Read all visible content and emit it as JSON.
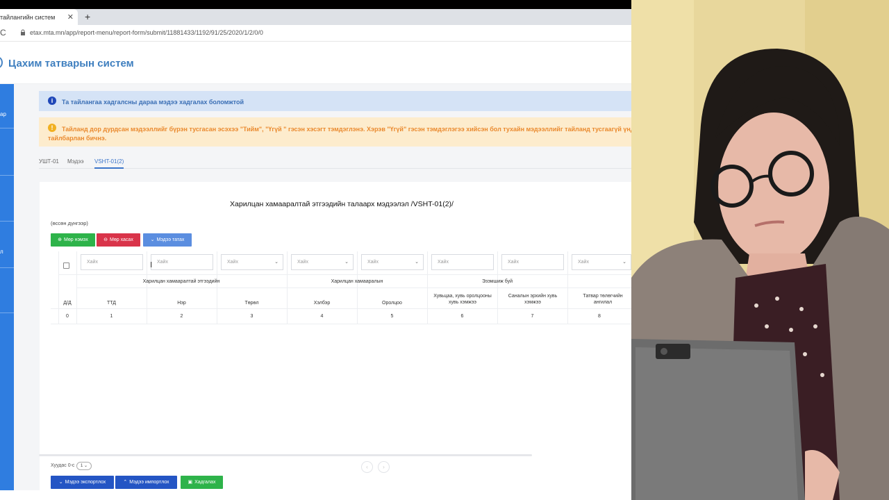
{
  "browser": {
    "tab_title": "тайлангийн систем",
    "tab_close": "✕",
    "new_tab": "+",
    "reload": "C",
    "url": "etax.mta.mn/app/report-menu/report-form/submit/11881433/1192/91/25/2020/1/2/0/0"
  },
  "app": {
    "title": "Цахим татварын систем"
  },
  "sidebar": {
    "items": [
      {
        "label": "ар"
      },
      {
        "label": "л"
      }
    ]
  },
  "alerts": {
    "info_icon": "i",
    "info": "Та тайлангаа хадгалсны дараа мэдээ хадгалах боломжтой",
    "warn_icon": "!",
    "warn_line1": "Тайланд дор дурдсан мэдээллийг бүрэн тусгасан эсэхээ \"Тийм\", \"Үгүй \" гэсэн хэсэгт тэмдэглэнэ. Хэрэв \"Үгүй\" гэсэн тэмдэглэгээ хийсэн бол тухайн мэдээллийг тайланд тусгаагүй үндэсл",
    "warn_line2": "тайлбарлан бичнэ."
  },
  "form_tabs": [
    {
      "label": "УШТ-01"
    },
    {
      "label": "Мэдээ"
    },
    {
      "label": "VSHT-01(2)"
    }
  ],
  "report": {
    "title": "Харилцан хамааралтай этгээдийн талаарх мэдээлэл /VSHT-01(2)/",
    "unit_note": "(өссөн дүнгээр)",
    "buttons": {
      "add_row": "Мөр нэмэх",
      "add_row_icon": "⊕",
      "remove_row": "Мөр хасах",
      "remove_row_icon": "⊖",
      "download": "Мэдээ татах",
      "download_icon": "⌄"
    },
    "filters": [
      {
        "placeholder": "Хайх",
        "type": "text"
      },
      {
        "placeholder": "Хайх",
        "type": "text"
      },
      {
        "placeholder": "Хайх",
        "type": "select"
      },
      {
        "placeholder": "Хайх",
        "type": "select"
      },
      {
        "placeholder": "Хайх",
        "type": "select"
      },
      {
        "placeholder": "Хайх",
        "type": "text"
      },
      {
        "placeholder": "Хайх",
        "type": "text"
      },
      {
        "placeholder": "Хайх",
        "type": "select"
      }
    ],
    "caret": "⌄",
    "group_headers": [
      {
        "label": "Харилцан хамааралтай этгээдийн"
      },
      {
        "label": "Харилцан хамааралын"
      },
      {
        "label": "Эзэмшиж буй"
      }
    ],
    "columns": [
      {
        "label": "Д/Д",
        "number": "0"
      },
      {
        "label": "ТТД",
        "number": "1"
      },
      {
        "label": "Нэр",
        "number": "2"
      },
      {
        "label": "Төрөл",
        "number": "3"
      },
      {
        "label": "Хэлбэр",
        "number": "4"
      },
      {
        "label": "Оролцоо",
        "number": "5"
      },
      {
        "label": "Хувьцаа, хувь оролцооны хувь хэмжээ",
        "number": "6"
      },
      {
        "label": "Саналын эрхийн хувь хэмжээ",
        "number": "7"
      },
      {
        "label": "Татвар төлөгчийн ангилал",
        "number": "8"
      }
    ]
  },
  "pagination": {
    "info": "Хуудас 0-с",
    "page": "1 ⌄",
    "prev": "‹",
    "next": "›"
  },
  "footer_buttons": {
    "export": "Мэдээ экспортлох",
    "export_icon": "⌄",
    "import": "Мэдээ импортлох",
    "import_icon": "⌃",
    "save": "Хадгалах",
    "save_icon": "▣"
  },
  "colors": {
    "primary": "#2f7de0",
    "title": "#3f7fbf",
    "info_bg": "#d5e3f6",
    "warn_bg": "#fdeccd",
    "warn_text": "#ea8a2f",
    "green": "#2eb34a",
    "red": "#d9344a",
    "navy": "#2455c4"
  }
}
